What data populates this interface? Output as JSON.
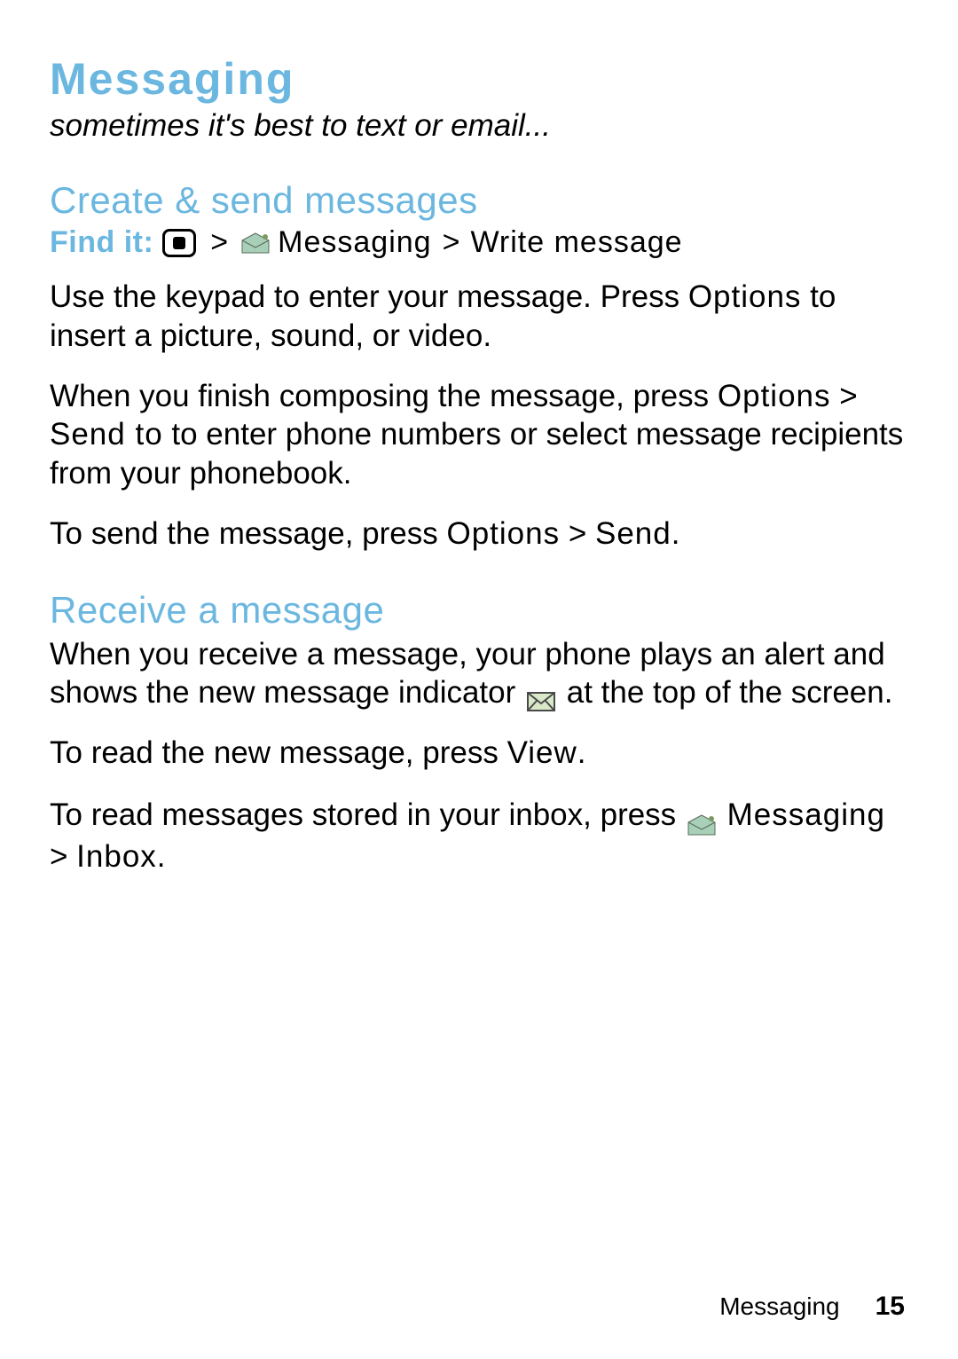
{
  "colors": {
    "accent": "#6bb7e0"
  },
  "title": "Messaging",
  "subtitle": "sometimes it's best to text or email...",
  "section1": {
    "heading": "Create & send messages",
    "find_it_label": "Find it:",
    "gt1": ">",
    "path_part1": "Messaging",
    "gt2": ">",
    "path_part2": "Write message",
    "para1a": "Use the keypad to enter your message. Press ",
    "para1b": "Options",
    "para1c": " to insert a picture, sound, or video.",
    "para2a": "When you finish composing the message, press ",
    "para2b": "Options",
    "para2c": " > ",
    "para2d": "Send to",
    "para2e": " to enter phone numbers or select message recipients from your phonebook.",
    "para3a": "To send the message, press ",
    "para3b": "Options",
    "para3c": " > ",
    "para3d": "Send",
    "para3e": "."
  },
  "section2": {
    "heading": "Receive a message",
    "para1a": "When you receive a message, your phone plays an alert and shows the new message indicator ",
    "para1b": " at the top of the screen.",
    "para2a": "To read the new message, press ",
    "para2b": "View",
    "para2c": ".",
    "para3a": "To read messages stored in your inbox, press ",
    "para3b": "Messaging",
    "para3c": " > ",
    "para3d": "Inbox",
    "para3e": "."
  },
  "footer": {
    "section": "Messaging",
    "page": "15"
  }
}
